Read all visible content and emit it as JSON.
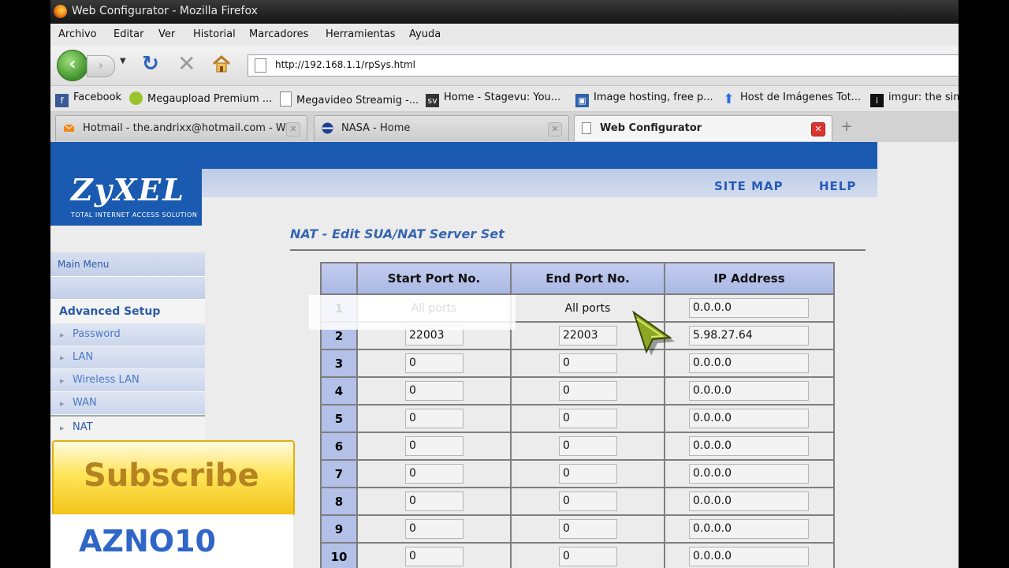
{
  "window": {
    "title": "Web Configurator - Mozilla Firefox"
  },
  "menu": [
    "Archivo",
    "Editar",
    "Ver",
    "Historial",
    "Marcadores",
    "Herramientas",
    "Ayuda"
  ],
  "nav": {
    "url": "http://192.168.1.1/rpSys.html"
  },
  "bookmarks": [
    "Facebook",
    "Megaupload Premium ...",
    "Megavideo Streamig -...",
    "Home - Stagevu: You...",
    "Image hosting, free p...",
    "Host de Imágenes Tot...",
    "imgur: the sim"
  ],
  "tabs": [
    {
      "label": "Hotmail - the.andrixx@hotmail.com - Wi..."
    },
    {
      "label": "NASA - Home"
    },
    {
      "label": "Web Configurator"
    }
  ],
  "header": {
    "brand": "ZyXEL",
    "tagline": "TOTAL INTERNET ACCESS SOLUTION",
    "site_map": "SITE MAP",
    "help": "HELP"
  },
  "sidebar": {
    "main_menu": "Main Menu",
    "advanced_setup": "Advanced Setup",
    "items": [
      "Password",
      "LAN",
      "Wireless LAN",
      "WAN",
      "NAT"
    ]
  },
  "page": {
    "title": "NAT - Edit SUA/NAT Server Set"
  },
  "table": {
    "headers": [
      "Start Port No.",
      "End Port No.",
      "IP Address"
    ],
    "rows": [
      {
        "num": "1",
        "start": "All ports",
        "end": "All ports",
        "ip": "0.0.0.0"
      },
      {
        "num": "2",
        "start": "22003",
        "end": "22003",
        "ip": "5.98.27.64"
      },
      {
        "num": "3",
        "start": "0",
        "end": "0",
        "ip": "0.0.0.0"
      },
      {
        "num": "4",
        "start": "0",
        "end": "0",
        "ip": "0.0.0.0"
      },
      {
        "num": "5",
        "start": "0",
        "end": "0",
        "ip": "0.0.0.0"
      },
      {
        "num": "6",
        "start": "0",
        "end": "0",
        "ip": "0.0.0.0"
      },
      {
        "num": "7",
        "start": "0",
        "end": "0",
        "ip": "0.0.0.0"
      },
      {
        "num": "8",
        "start": "0",
        "end": "0",
        "ip": "0.0.0.0"
      },
      {
        "num": "9",
        "start": "0",
        "end": "0",
        "ip": "0.0.0.0"
      },
      {
        "num": "10",
        "start": "0",
        "end": "0",
        "ip": "0.0.0.0"
      }
    ]
  },
  "overlay": {
    "subscribe": "Subscribe",
    "channel": "AZNO10"
  }
}
